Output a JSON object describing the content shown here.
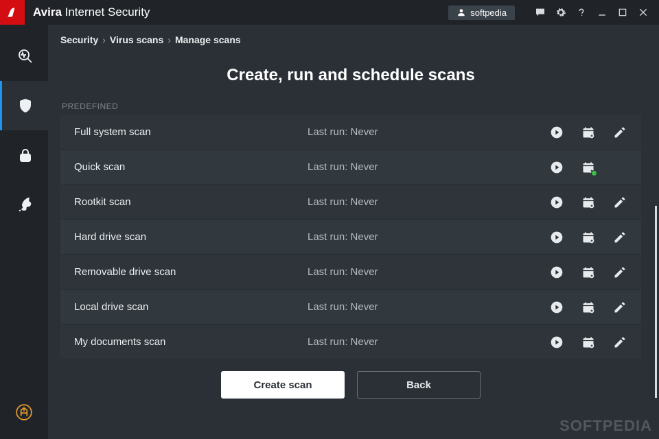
{
  "app": {
    "brand_strong": "Avira",
    "brand_rest": " Internet Security"
  },
  "titlebar": {
    "user": "softpedia"
  },
  "breadcrumb": {
    "root": "Security",
    "mid": "Virus scans",
    "leaf": "Manage scans"
  },
  "page": {
    "title": "Create, run and schedule scans",
    "section_label": "PREDEFINED"
  },
  "scans": [
    {
      "name": "Full system scan",
      "status": "Last run: Never",
      "has_edit": true,
      "scheduled": false
    },
    {
      "name": "Quick scan",
      "status": "Last run: Never",
      "has_edit": false,
      "scheduled": true
    },
    {
      "name": "Rootkit scan",
      "status": "Last run: Never",
      "has_edit": true,
      "scheduled": false
    },
    {
      "name": "Hard drive scan",
      "status": "Last run: Never",
      "has_edit": true,
      "scheduled": false
    },
    {
      "name": "Removable drive scan",
      "status": "Last run: Never",
      "has_edit": true,
      "scheduled": false
    },
    {
      "name": "Local drive scan",
      "status": "Last run: Never",
      "has_edit": true,
      "scheduled": false
    },
    {
      "name": "My documents scan",
      "status": "Last run: Never",
      "has_edit": true,
      "scheduled": false
    }
  ],
  "footer": {
    "create": "Create scan",
    "back": "Back"
  },
  "watermark": "SOFTPEDIA"
}
